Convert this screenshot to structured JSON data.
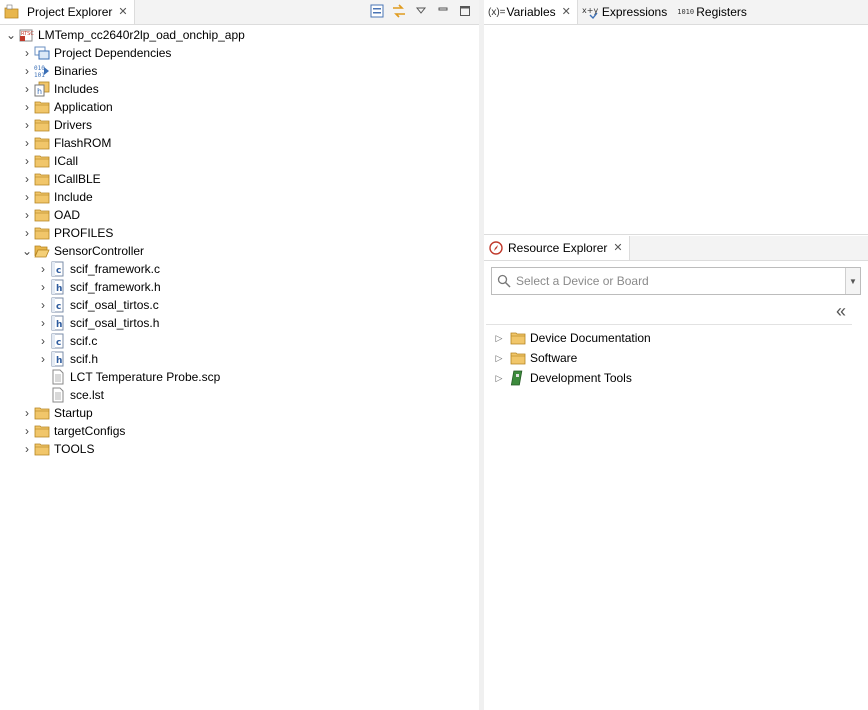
{
  "project_explorer": {
    "tab_label": "Project Explorer",
    "project": {
      "name": "LMTemp_cc2640r2lp_oad_onchip_app",
      "children": [
        {
          "label": "Project Dependencies",
          "icon": "dependencies-icon"
        },
        {
          "label": "Binaries",
          "icon": "binaries-icon"
        },
        {
          "label": "Includes",
          "icon": "includes-icon"
        },
        {
          "label": "Application",
          "icon": "folder-icon"
        },
        {
          "label": "Drivers",
          "icon": "folder-icon"
        },
        {
          "label": "FlashROM",
          "icon": "folder-icon"
        },
        {
          "label": "ICall",
          "icon": "folder-icon"
        },
        {
          "label": "ICallBLE",
          "icon": "folder-icon"
        },
        {
          "label": "Include",
          "icon": "folder-icon"
        },
        {
          "label": "OAD",
          "icon": "folder-icon"
        },
        {
          "label": "PROFILES",
          "icon": "folder-icon"
        },
        {
          "label": "SensorController",
          "icon": "folder-open-icon"
        },
        {
          "label": "Startup",
          "icon": "folder-icon"
        },
        {
          "label": "targetConfigs",
          "icon": "folder-icon"
        },
        {
          "label": "TOOLS",
          "icon": "folder-icon"
        }
      ],
      "sensor_controller_files": [
        {
          "label": "scif_framework.c",
          "type": "c"
        },
        {
          "label": "scif_framework.h",
          "type": "h"
        },
        {
          "label": "scif_osal_tirtos.c",
          "type": "c"
        },
        {
          "label": "scif_osal_tirtos.h",
          "type": "h"
        },
        {
          "label": "scif.c",
          "type": "c"
        },
        {
          "label": "scif.h",
          "type": "h"
        },
        {
          "label": "LCT Temperature Probe.scp",
          "type": "file"
        },
        {
          "label": "sce.lst",
          "type": "file"
        }
      ]
    }
  },
  "debug_views": {
    "variables_label": "Variables",
    "variables_icon_text": "(x)=",
    "expressions_label": "Expressions",
    "registers_label": "Registers",
    "registers_icon_text": "1010"
  },
  "resource_explorer": {
    "tab_label": "Resource Explorer",
    "search_placeholder": "Select a Device or Board",
    "collapse_glyph": "«",
    "items": [
      {
        "label": "Device Documentation",
        "icon": "folder-icon"
      },
      {
        "label": "Software",
        "icon": "software-folder-icon"
      },
      {
        "label": "Development Tools",
        "icon": "board-icon"
      }
    ]
  },
  "colors": {
    "folder": "#e8b64c",
    "accent_blue": "#3b6fb6",
    "tab_bg": "#f3f3f3"
  }
}
